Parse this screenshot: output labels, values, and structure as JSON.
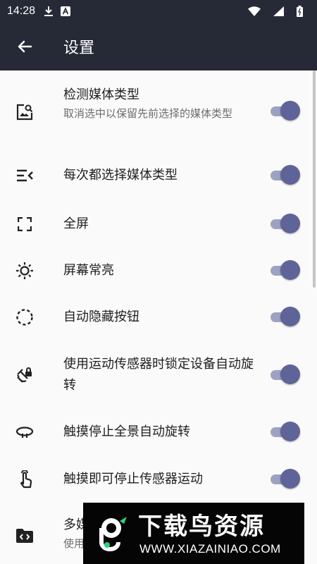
{
  "status_bar": {
    "time": "14:28",
    "left_icons": [
      "download-icon",
      "notification-a-icon"
    ],
    "right_icons": [
      "wifi-icon",
      "signal-icon",
      "battery-icon"
    ]
  },
  "app_bar": {
    "title": "设置",
    "back_icon": "arrow-back-icon"
  },
  "settings": [
    {
      "icon": "image-search-icon",
      "title": "检测媒体类型",
      "summary": "取消选中以保留先前选择的媒体类型",
      "enabled": true
    },
    {
      "icon": "list-select-icon",
      "title": "每次都选择媒体类型",
      "summary": "",
      "enabled": true
    },
    {
      "icon": "fullscreen-icon",
      "title": "全屏",
      "summary": "",
      "enabled": true
    },
    {
      "icon": "brightness-icon",
      "title": "屏幕常亮",
      "summary": "",
      "enabled": true
    },
    {
      "icon": "dashed-circle-icon",
      "title": "自动隐藏按钮",
      "summary": "",
      "enabled": true
    },
    {
      "icon": "screen-lock-rotation-icon",
      "title": "使用运动传感器时锁定设备自动旋转",
      "summary": "",
      "enabled": true
    },
    {
      "icon": "panorama-rotate-icon",
      "title": "触摸停止全景自动旋转",
      "summary": "",
      "enabled": true
    },
    {
      "icon": "touch-icon",
      "title": "触摸即可停止传感器运动",
      "summary": "",
      "enabled": true
    },
    {
      "icon": "folder-code-icon",
      "title": "多媒",
      "summary": "使用",
      "enabled": null
    }
  ],
  "watermark": {
    "name": "下载鸟资源",
    "url": "WWW.XIAZAINIAO.COM"
  },
  "colors": {
    "bar": "#262a36",
    "switch_thumb": "#5e6497",
    "switch_track": "#9ea2c2"
  }
}
